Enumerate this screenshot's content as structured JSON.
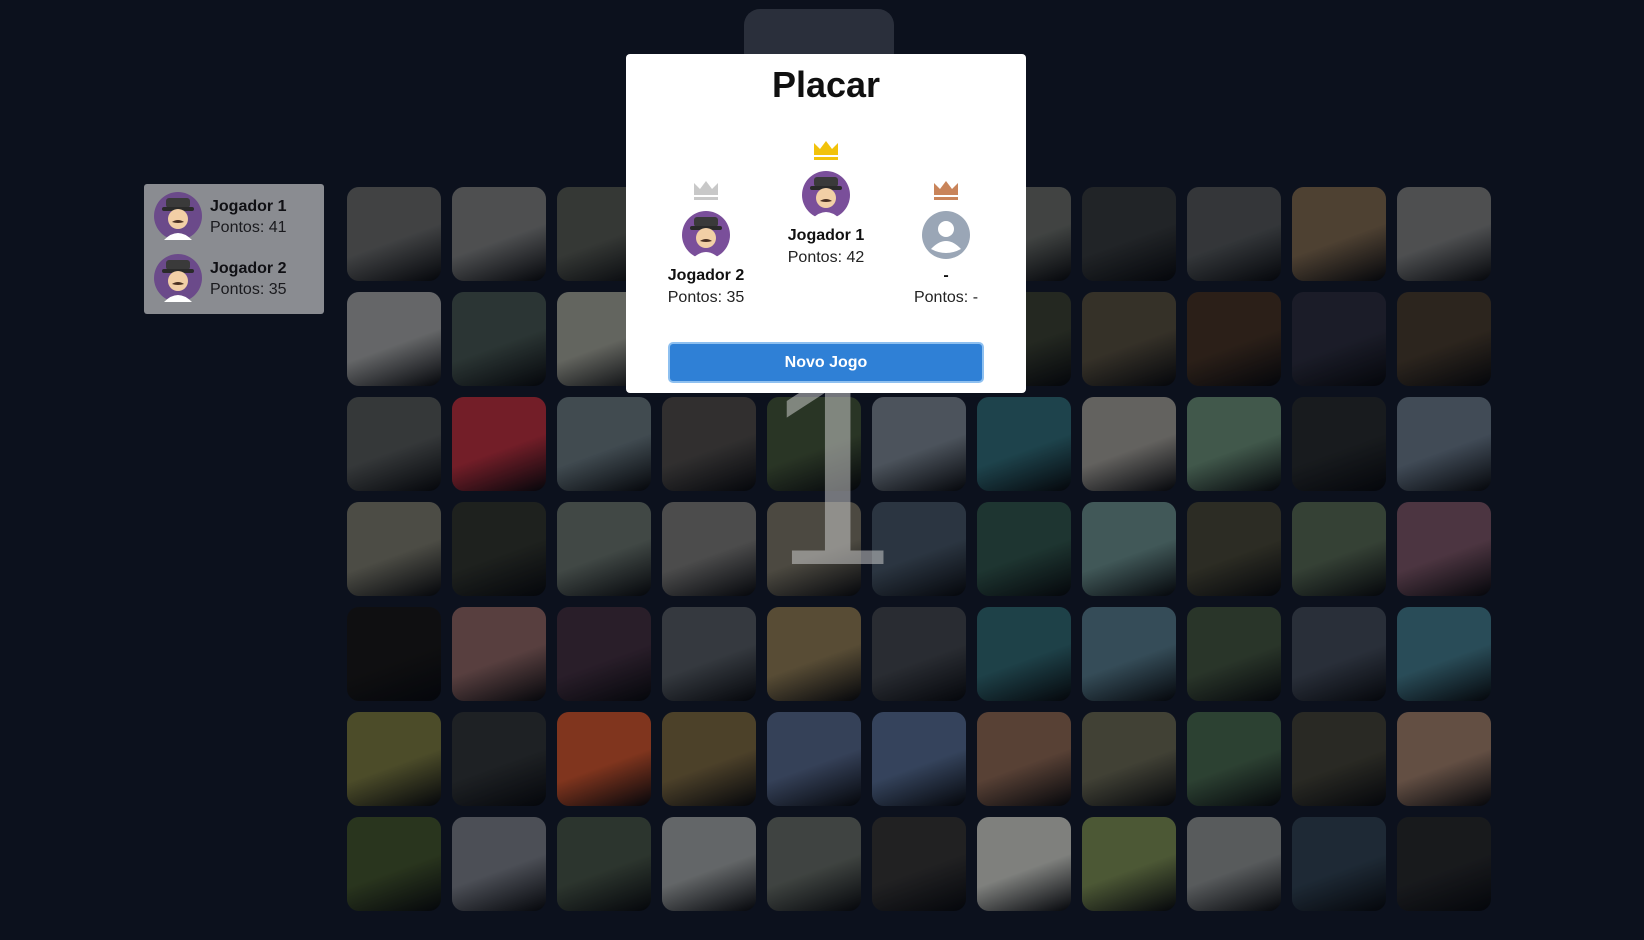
{
  "scoreboard": {
    "title": "Placar",
    "second": {
      "name": "Jogador 2",
      "score": "Pontos: 35",
      "crown_color": "#c8c8c8"
    },
    "first": {
      "name": "Jogador 1",
      "score": "Pontos: 42",
      "crown_color": "#f2c20a"
    },
    "third": {
      "name": "-",
      "score": "Pontos: -",
      "crown_color": "#c9845a"
    },
    "new_game_label": "Novo Jogo"
  },
  "players_panel": [
    {
      "name": "Jogador 1",
      "score": "Pontos: 41"
    },
    {
      "name": "Jogador 2",
      "score": "Pontos: 35"
    }
  ],
  "board": {
    "turn_indicator": "1",
    "rows": 7,
    "cols": 11,
    "tile_colors": [
      "#5a5c5e",
      "#6c6e70",
      "#4a4e4a",
      "#3a3c3e",
      "#3c4450",
      "#6a3c2c",
      "#5a5e5c",
      "#2e3236",
      "#484c50",
      "#6c5a46",
      "#6c6e70",
      "#8c8e90",
      "#3c4a48",
      "#8a8c84",
      "#6c6a64",
      "#484a48",
      "#383c36",
      "#32382e",
      "#4a4438",
      "#3c2c22",
      "#262838",
      "#3e342a",
      "#4a4e50",
      "#a02a38",
      "#5a6870",
      "#444242",
      "#3a4a34",
      "#6a7480",
      "#2a5e6a",
      "#8a8884",
      "#5a7a68",
      "#22262a",
      "#5a6878",
      "#6a6a60",
      "#2a2e2a",
      "#5a6460",
      "#6a6a6a",
      "#6a665a",
      "#3c4a5a",
      "#2a4a44",
      "#5a7a7a",
      "#3e3e32",
      "#4a5a4a",
      "#6a4a5a",
      "#161618",
      "#7a5858",
      "#3a2a3a",
      "#4a5058",
      "#7a6a4a",
      "#3a3e46",
      "#2a5a64",
      "#4a6a7a",
      "#3a4a3a",
      "#3a4250",
      "#3a6a7a",
      "#6a6a3a",
      "#2a2e32",
      "#b24a2a",
      "#6a5a3a",
      "#4a5a7a",
      "#4a5e80",
      "#7a5a4a",
      "#5a5a4a",
      "#3e5a46",
      "#3a3a32",
      "#8a6e5e",
      "#3a4a2a",
      "#6a6e78",
      "#3e4a40",
      "#8a8e90",
      "#585e5a",
      "#2e2e30",
      "#b0b2ae",
      "#6a7a4a",
      "#7a7e80",
      "#2a3a4a",
      "#222428"
    ]
  }
}
